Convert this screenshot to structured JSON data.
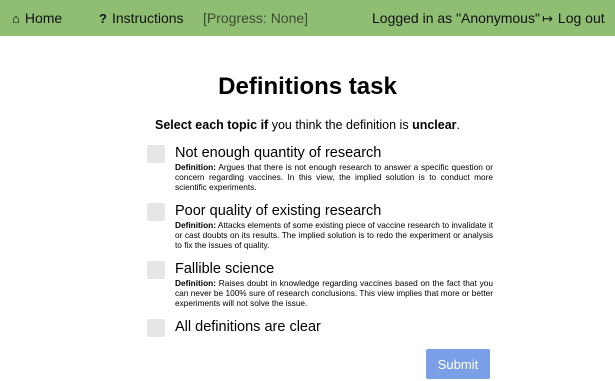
{
  "nav": {
    "home": {
      "icon": "home-icon",
      "glyph": "⌂",
      "label": "Home"
    },
    "instructions": {
      "icon": "question-icon",
      "glyph": "?",
      "label": "Instructions"
    },
    "progress": "[Progress: None]",
    "user": "Logged in as \"Anonymous\"",
    "logout": {
      "icon": "logout-icon",
      "glyph": "↦",
      "label": "Log out"
    },
    "bar_color": "#8fbe72"
  },
  "title": "Definitions task",
  "instruction": {
    "bold_prefix": "Select each topic if",
    "middle": " you think the definition is ",
    "bold_suffix": "unclear",
    "end": "."
  },
  "options": [
    {
      "label": "Not enough quantity of research",
      "def_label": "Definition:",
      "def_text": " Argues that there is not enough research to answer a specific question or concern regarding vaccines. In this view, the implied solution is to conduct more scientific experiments."
    },
    {
      "label": "Poor quality of existing research",
      "def_label": "Definition:",
      "def_text": " Attacks elements of some existing piece of vaccine research to invalidate it or cast doubts on its results. The implied solution is to redo the experiment or analysis to fix the issues of quality."
    },
    {
      "label": "Fallible science",
      "def_label": "Definition:",
      "def_text": " Raises doubt in knowledge regarding vaccines based on the fact that you can never be 100% sure of research conclusions. This view implies that more or better experiments will not solve the issue."
    },
    {
      "label": "All definitions are clear"
    }
  ],
  "submit_label": "Submit",
  "submit_color": "#7b9fe6"
}
